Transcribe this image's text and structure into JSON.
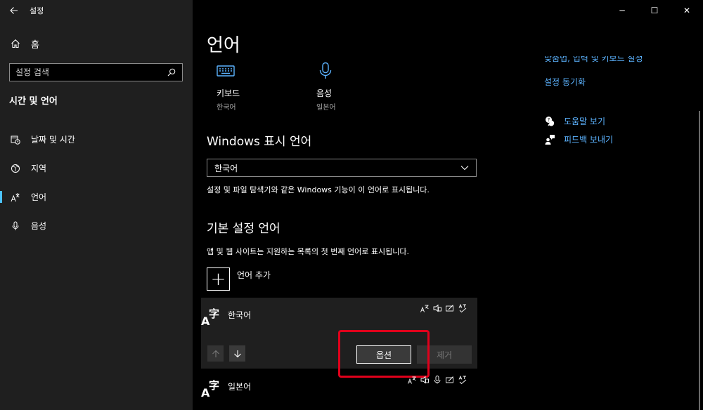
{
  "titlebar": {
    "back_icon": "back-arrow-icon",
    "app_title": "설정"
  },
  "window_controls": {
    "minimize": "─",
    "maximize": "☐",
    "close": "✕"
  },
  "sidebar": {
    "home_label": "홈",
    "search_placeholder": "설정 검색",
    "section_title": "시간 및 언어",
    "items": [
      {
        "label": "날짜 및 시간",
        "icon": "calendar-clock-icon",
        "selected": false
      },
      {
        "label": "지역",
        "icon": "globe-icon",
        "selected": false
      },
      {
        "label": "언어",
        "icon": "language-icon",
        "selected": true
      },
      {
        "label": "음성",
        "icon": "microphone-icon",
        "selected": false
      }
    ]
  },
  "main": {
    "page_title": "언어",
    "quick_links": [
      {
        "label": "키보드",
        "sub": "한국어",
        "icon": "keyboard-icon"
      },
      {
        "label": "음성",
        "sub": "일본어",
        "icon": "microphone-icon"
      }
    ],
    "display_language": {
      "heading": "Windows 표시 언어",
      "selected": "한국어",
      "description": "설정 및 파일 탐색기와 같은 Windows 기능이 이 언어로 표시됩니다."
    },
    "preferred_languages": {
      "heading": "기본 설정 언어",
      "description": "앱 및 웹 사이트는 지원하는 목록의 첫 번째 언어로 표시됩니다.",
      "add_label": "언어 추가",
      "languages": [
        {
          "name": "한국어"
        },
        {
          "name": "일본어"
        }
      ],
      "options_label": "옵션",
      "remove_label": "제거"
    }
  },
  "right_column": {
    "partial_link": "맞춤법, 입력 및 키보드 설정",
    "sync_link": "설정 동기화",
    "help_link": "도움말 보기",
    "feedback_link": "피드백 보내기"
  },
  "colors": {
    "accent": "#4cc2ff",
    "link": "#5cb3ff",
    "highlight": "#e0001b",
    "sidebar_bg": "#1f1f1f"
  }
}
